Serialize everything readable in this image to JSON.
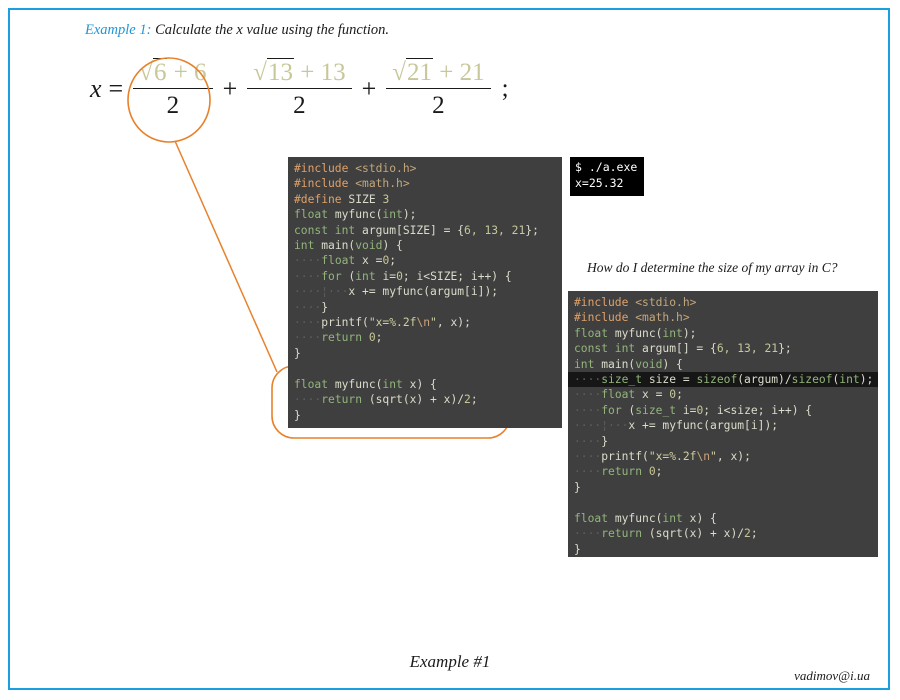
{
  "slide": {
    "border_color": "#1a9fe0",
    "accent_color": "#e8812a",
    "heading_label": "Example 1:",
    "heading_text": "Calculate the x value using the function."
  },
  "formula": {
    "lhs": "x",
    "equals": "=",
    "terms": [
      {
        "numerator_radical": "6",
        "numerator_rest": "+ 6",
        "denominator": "2"
      },
      {
        "numerator_radical": "13",
        "numerator_rest": "+ 13",
        "denominator": "2"
      },
      {
        "numerator_radical": "21",
        "numerator_rest": "+ 21",
        "denominator": "2"
      }
    ],
    "plus": "+",
    "terminator": ";",
    "circled_term_index": 0
  },
  "code_left": {
    "lines": [
      [
        {
          "t": "#include ",
          "c": "pre"
        },
        {
          "t": "<stdio.h>",
          "c": "hdr"
        }
      ],
      [
        {
          "t": "#include ",
          "c": "pre"
        },
        {
          "t": "<math.h>",
          "c": "hdr"
        }
      ],
      [
        {
          "t": "#define ",
          "c": "pre"
        },
        {
          "t": "SIZE ",
          "c": "fn"
        },
        {
          "t": "3",
          "c": "num"
        }
      ],
      [
        {
          "t": "float ",
          "c": "kw"
        },
        {
          "t": "myfunc(",
          "c": "fn"
        },
        {
          "t": "int",
          "c": "kw"
        },
        {
          "t": ");",
          "c": "fn"
        }
      ],
      [
        {
          "t": "const int ",
          "c": "kw"
        },
        {
          "t": "argum[SIZE] = {",
          "c": "fn"
        },
        {
          "t": "6, 13, 21",
          "c": "num"
        },
        {
          "t": "};",
          "c": "fn"
        }
      ],
      [
        {
          "t": "int ",
          "c": "kw"
        },
        {
          "t": "main(",
          "c": "fn"
        },
        {
          "t": "void",
          "c": "kw"
        },
        {
          "t": ") {",
          "c": "fn"
        }
      ],
      [
        {
          "t": "····",
          "c": "dot"
        },
        {
          "t": "float ",
          "c": "kw"
        },
        {
          "t": "x =",
          "c": "fn"
        },
        {
          "t": "0",
          "c": "num"
        },
        {
          "t": ";",
          "c": "fn"
        }
      ],
      [
        {
          "t": "····",
          "c": "dot"
        },
        {
          "t": "for ",
          "c": "kw"
        },
        {
          "t": "(",
          "c": "fn"
        },
        {
          "t": "int ",
          "c": "kw"
        },
        {
          "t": "i=",
          "c": "fn"
        },
        {
          "t": "0",
          "c": "num"
        },
        {
          "t": "; i<SIZE; i++) {",
          "c": "fn"
        }
      ],
      [
        {
          "t": "····¦···",
          "c": "dot"
        },
        {
          "t": "x += myfunc(argum[i]);",
          "c": "fn"
        }
      ],
      [
        {
          "t": "····",
          "c": "dot"
        },
        {
          "t": "}",
          "c": "fn"
        }
      ],
      [
        {
          "t": "····",
          "c": "dot"
        },
        {
          "t": "printf(",
          "c": "fn"
        },
        {
          "t": "\"x=%.2f",
          "c": "str"
        },
        {
          "t": "\\n",
          "c": "esc"
        },
        {
          "t": "\"",
          "c": "str"
        },
        {
          "t": ", x);",
          "c": "fn"
        }
      ],
      [
        {
          "t": "····",
          "c": "dot"
        },
        {
          "t": "return ",
          "c": "kw"
        },
        {
          "t": "0",
          "c": "num"
        },
        {
          "t": ";",
          "c": "fn"
        }
      ],
      [
        {
          "t": "}",
          "c": "fn"
        }
      ],
      [
        {
          "t": " ",
          "c": "fn"
        }
      ],
      [
        {
          "t": "float ",
          "c": "kw"
        },
        {
          "t": "myfunc(",
          "c": "fn"
        },
        {
          "t": "int ",
          "c": "kw"
        },
        {
          "t": "x) {",
          "c": "fn"
        }
      ],
      [
        {
          "t": "····",
          "c": "dot"
        },
        {
          "t": "return ",
          "c": "kw"
        },
        {
          "t": "(sqrt(x) + x)/",
          "c": "fn"
        },
        {
          "t": "2",
          "c": "num"
        },
        {
          "t": ";",
          "c": "fn"
        }
      ],
      [
        {
          "t": "}",
          "c": "fn"
        }
      ]
    ]
  },
  "terminal": {
    "lines": [
      "$ ./a.exe",
      "x=25.32"
    ]
  },
  "question": {
    "text": "How do I determine the size of my array in C?"
  },
  "code_right": {
    "highlight_line_index": 5,
    "lines": [
      [
        {
          "t": "#include ",
          "c": "pre"
        },
        {
          "t": "<stdio.h>",
          "c": "hdr"
        }
      ],
      [
        {
          "t": "#include ",
          "c": "pre"
        },
        {
          "t": "<math.h>",
          "c": "hdr"
        }
      ],
      [
        {
          "t": "float ",
          "c": "kw"
        },
        {
          "t": "myfunc(",
          "c": "fn"
        },
        {
          "t": "int",
          "c": "kw"
        },
        {
          "t": ");",
          "c": "fn"
        }
      ],
      [
        {
          "t": "const int ",
          "c": "kw"
        },
        {
          "t": "argum[] = {",
          "c": "fn"
        },
        {
          "t": "6, 13, 21",
          "c": "num"
        },
        {
          "t": "};",
          "c": "fn"
        }
      ],
      [
        {
          "t": "int ",
          "c": "kw"
        },
        {
          "t": "main(",
          "c": "fn"
        },
        {
          "t": "void",
          "c": "kw"
        },
        {
          "t": ") {",
          "c": "fn"
        }
      ],
      [
        {
          "t": "····",
          "c": "dot"
        },
        {
          "t": "size_t ",
          "c": "kw"
        },
        {
          "t": "size = ",
          "c": "fn"
        },
        {
          "t": "sizeof",
          "c": "kw"
        },
        {
          "t": "(argum)/",
          "c": "fn"
        },
        {
          "t": "sizeof",
          "c": "kw"
        },
        {
          "t": "(",
          "c": "fn"
        },
        {
          "t": "int",
          "c": "kw"
        },
        {
          "t": ");",
          "c": "fn"
        }
      ],
      [
        {
          "t": "····",
          "c": "dot"
        },
        {
          "t": "float ",
          "c": "kw"
        },
        {
          "t": "x = ",
          "c": "fn"
        },
        {
          "t": "0",
          "c": "num"
        },
        {
          "t": ";",
          "c": "fn"
        }
      ],
      [
        {
          "t": "····",
          "c": "dot"
        },
        {
          "t": "for ",
          "c": "kw"
        },
        {
          "t": "(",
          "c": "fn"
        },
        {
          "t": "size_t ",
          "c": "kw"
        },
        {
          "t": "i=",
          "c": "fn"
        },
        {
          "t": "0",
          "c": "num"
        },
        {
          "t": "; i<size; i++) {",
          "c": "fn"
        }
      ],
      [
        {
          "t": "····¦···",
          "c": "dot"
        },
        {
          "t": "x += myfunc(argum[i]);",
          "c": "fn"
        }
      ],
      [
        {
          "t": "····",
          "c": "dot"
        },
        {
          "t": "}",
          "c": "fn"
        }
      ],
      [
        {
          "t": "····",
          "c": "dot"
        },
        {
          "t": "printf(",
          "c": "fn"
        },
        {
          "t": "\"x=%.2f",
          "c": "str"
        },
        {
          "t": "\\n",
          "c": "esc"
        },
        {
          "t": "\"",
          "c": "str"
        },
        {
          "t": ", x);",
          "c": "fn"
        }
      ],
      [
        {
          "t": "····",
          "c": "dot"
        },
        {
          "t": "return ",
          "c": "kw"
        },
        {
          "t": "0",
          "c": "num"
        },
        {
          "t": ";",
          "c": "fn"
        }
      ],
      [
        {
          "t": "}",
          "c": "fn"
        }
      ],
      [
        {
          "t": " ",
          "c": "fn"
        }
      ],
      [
        {
          "t": "float ",
          "c": "kw"
        },
        {
          "t": "myfunc(",
          "c": "fn"
        },
        {
          "t": "int ",
          "c": "kw"
        },
        {
          "t": "x) {",
          "c": "fn"
        }
      ],
      [
        {
          "t": "····",
          "c": "dot"
        },
        {
          "t": "return ",
          "c": "kw"
        },
        {
          "t": "(sqrt(x) + x)/",
          "c": "fn"
        },
        {
          "t": "2",
          "c": "num"
        },
        {
          "t": ";",
          "c": "fn"
        }
      ],
      [
        {
          "t": "}",
          "c": "fn"
        }
      ]
    ]
  },
  "footer": {
    "caption": "Example #1",
    "email": "vadimov@i.ua"
  }
}
